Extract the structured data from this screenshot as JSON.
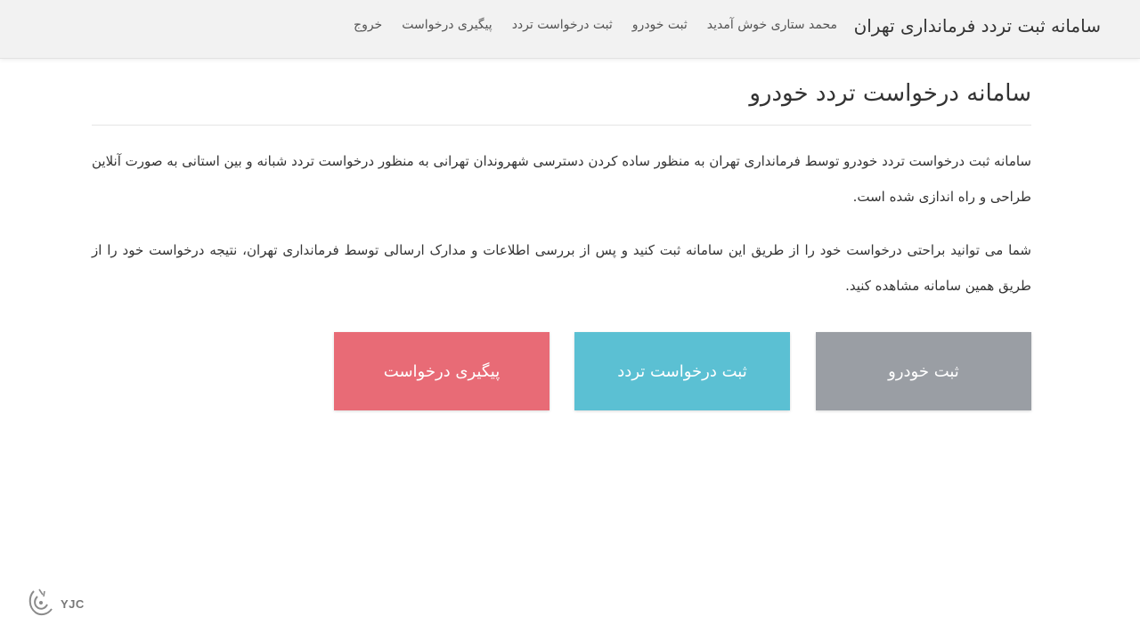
{
  "header": {
    "brand": "سامانه ثبت تردد فرمانداری تهران",
    "welcome": "محمد ستاری خوش آمدید",
    "nav": [
      "ثبت خودرو",
      "ثبت درخواست تردد",
      "پیگیری درخواست",
      "خروج"
    ]
  },
  "main": {
    "title": "سامانه درخواست تردد خودرو",
    "paragraph1": "سامانه ثبت درخواست تردد خودرو توسط فرمانداری تهران به منظور ساده کردن دسترسی شهروندان تهرانی به منظور درخواست تردد شبانه و بین استانی به صورت آنلاین طراحی و راه اندازی شده است.",
    "paragraph2": "شما می توانید براحتی درخواست خود را از طریق این سامانه ثبت کنید و پس از بررسی اطلاعات و مدارک ارسالی توسط فرمانداری تهران، نتیجه درخواست خود را از طریق همین سامانه مشاهده کنید."
  },
  "buttons": {
    "register_vehicle": "ثبت خودرو",
    "register_request": "ثبت درخواست تردد",
    "track_request": "پیگیری درخواست"
  },
  "colors": {
    "gray_button": "#9a9ea4",
    "teal_button": "#5bc0d3",
    "red_button": "#e86b76"
  },
  "watermark": {
    "text": "YJC",
    "icon": "yjc-logo-icon"
  }
}
